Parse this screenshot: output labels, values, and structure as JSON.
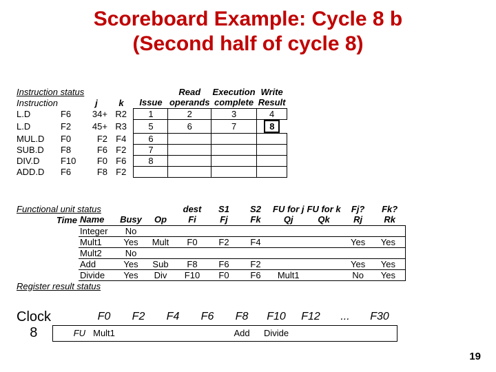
{
  "title_line1": "Scoreboard Example:  Cycle 8 b",
  "title_line2": "(Second half of cycle 8)",
  "instr_status_label": "Instruction status",
  "instr_hdr": {
    "instruction": "Instruction",
    "j": "j",
    "k": "k",
    "issue": "Issue",
    "read_top": "Read",
    "read_bot": "operands",
    "exec_top": "Execution",
    "exec_bot": "complete",
    "write_top": "Write",
    "write_bot": "Result"
  },
  "instr_rows": [
    {
      "op": "L.D",
      "d": "F6",
      "j": "34+",
      "k": "R2",
      "issue": "1",
      "read": "2",
      "exec": "3",
      "write": "4",
      "boxed": false
    },
    {
      "op": "L.D",
      "d": "F2",
      "j": "45+",
      "k": "R3",
      "issue": "5",
      "read": "6",
      "exec": "7",
      "write": "8",
      "boxed": true
    },
    {
      "op": "MUL.D",
      "d": "F0",
      "j": "F2",
      "k": "F4",
      "issue": "6",
      "read": "",
      "exec": "",
      "write": "",
      "boxed": false
    },
    {
      "op": "SUB.D",
      "d": "F8",
      "j": "F6",
      "k": "F2",
      "issue": "7",
      "read": "",
      "exec": "",
      "write": "",
      "boxed": false
    },
    {
      "op": "DIV.D",
      "d": "F10",
      "j": "F0",
      "k": "F6",
      "issue": "8",
      "read": "",
      "exec": "",
      "write": "",
      "boxed": false
    },
    {
      "op": "ADD.D",
      "d": "F6",
      "j": "F8",
      "k": "F2",
      "issue": "",
      "read": "",
      "exec": "",
      "write": "",
      "boxed": false
    }
  ],
  "fus_label": "Functional unit status",
  "fus_hdr_top": {
    "dest": "dest",
    "s1": "S1",
    "s2": "S2",
    "fuj": "FU for j",
    "fuk": "FU for k",
    "fjq": "Fj?",
    "fkq": "Fk?"
  },
  "fus_hdr_bot": {
    "time": "Time",
    "name": "Name",
    "busy": "Busy",
    "op": "Op",
    "fi": "Fi",
    "fj": "Fj",
    "fk": "Fk",
    "qj": "Qj",
    "qk": "Qk",
    "rj": "Rj",
    "rk": "Rk"
  },
  "fus_rows": [
    {
      "name": "Integer",
      "busy": "No",
      "op": "",
      "fi": "",
      "fj": "",
      "fk": "",
      "qj": "",
      "qk": "",
      "rj": "",
      "rk": ""
    },
    {
      "name": "Mult1",
      "busy": "Yes",
      "op": "Mult",
      "fi": "F0",
      "fj": "F2",
      "fk": "F4",
      "qj": "",
      "qk": "",
      "rj": "Yes",
      "rk": "Yes"
    },
    {
      "name": "Mult2",
      "busy": "No",
      "op": "",
      "fi": "",
      "fj": "",
      "fk": "",
      "qj": "",
      "qk": "",
      "rj": "",
      "rk": ""
    },
    {
      "name": "Add",
      "busy": "Yes",
      "op": "Sub",
      "fi": "F8",
      "fj": "F6",
      "fk": "F2",
      "qj": "",
      "qk": "",
      "rj": "Yes",
      "rk": "Yes"
    },
    {
      "name": "Divide",
      "busy": "Yes",
      "op": "Div",
      "fi": "F10",
      "fj": "F0",
      "fk": "F6",
      "qj": "Mult1",
      "qk": "",
      "rj": "No",
      "rk": "Yes"
    }
  ],
  "reg_label": "Register result status",
  "clock_label": "Clock",
  "clock_value": "8",
  "fu_label": "FU",
  "reg_hdr": [
    "F0",
    "F2",
    "F4",
    "F6",
    "F8",
    "F10",
    "F12",
    "...",
    "F30"
  ],
  "reg_row": [
    "Mult1",
    "",
    "",
    "",
    "Add",
    "Divide",
    "",
    "",
    ""
  ],
  "page_number": "19"
}
